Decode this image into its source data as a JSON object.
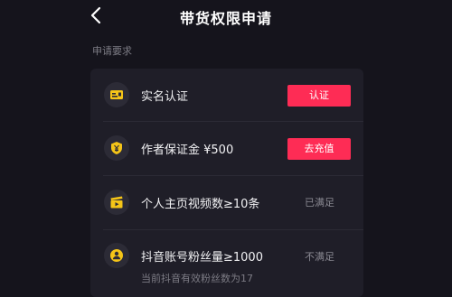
{
  "header": {
    "title": "带货权限申请"
  },
  "section": {
    "label": "申请要求"
  },
  "requirements": [
    {
      "icon": "id-card-icon",
      "label": "实名认证",
      "action": "认证"
    },
    {
      "icon": "yuan-shield-icon",
      "label": "作者保证金 ¥500",
      "action": "去充值"
    },
    {
      "icon": "video-clapper-icon",
      "label": "个人主页视频数≥10条",
      "status": "已满足"
    },
    {
      "icon": "followers-icon",
      "label": "抖音账号粉丝量≥1000",
      "status": "不满足",
      "sub": "当前抖音有效粉丝数为17"
    }
  ],
  "colors": {
    "accent": "#fe2c55",
    "icon": "#f5c518",
    "background": "#15141c",
    "card": "#1f1e28"
  }
}
